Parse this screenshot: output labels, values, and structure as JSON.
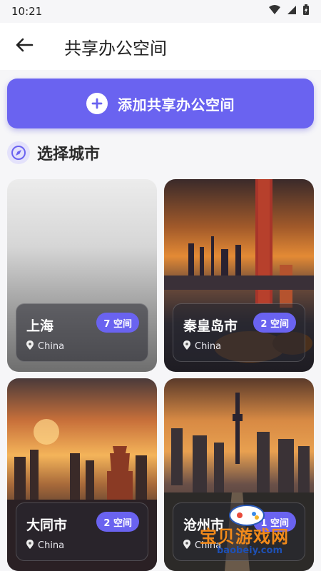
{
  "status": {
    "time": "10:21"
  },
  "appbar": {
    "title": "共享办公空间"
  },
  "add_button": {
    "label": "添加共享办公空间"
  },
  "section": {
    "title": "选择城市"
  },
  "cities": [
    {
      "name": "上海",
      "badge": "7 空间",
      "country": "China"
    },
    {
      "name": "秦皇岛市",
      "badge": "2 空间",
      "country": "China"
    },
    {
      "name": "大同市",
      "badge": "2 空间",
      "country": "China"
    },
    {
      "name": "沧州市",
      "badge": "1 空间",
      "country": "China"
    }
  ],
  "watermark": {
    "text": "宝贝游戏网",
    "url": "baobeiy.com"
  },
  "colors": {
    "accent": "#6a63f0"
  }
}
